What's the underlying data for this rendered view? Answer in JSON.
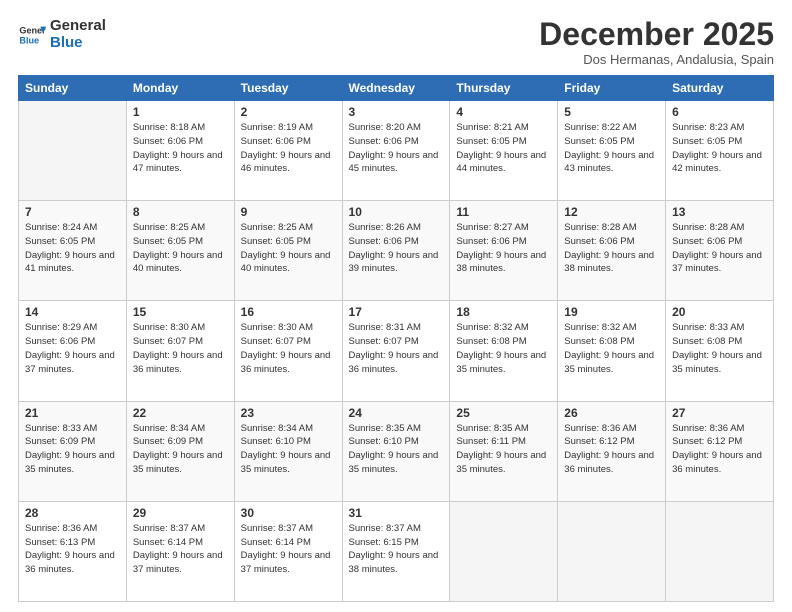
{
  "logo": {
    "line1": "General",
    "line2": "Blue"
  },
  "title": "December 2025",
  "subtitle": "Dos Hermanas, Andalusia, Spain",
  "days_header": [
    "Sunday",
    "Monday",
    "Tuesday",
    "Wednesday",
    "Thursday",
    "Friday",
    "Saturday"
  ],
  "weeks": [
    [
      {
        "num": "",
        "info": ""
      },
      {
        "num": "1",
        "info": "Sunrise: 8:18 AM\nSunset: 6:06 PM\nDaylight: 9 hours\nand 47 minutes."
      },
      {
        "num": "2",
        "info": "Sunrise: 8:19 AM\nSunset: 6:06 PM\nDaylight: 9 hours\nand 46 minutes."
      },
      {
        "num": "3",
        "info": "Sunrise: 8:20 AM\nSunset: 6:06 PM\nDaylight: 9 hours\nand 45 minutes."
      },
      {
        "num": "4",
        "info": "Sunrise: 8:21 AM\nSunset: 6:05 PM\nDaylight: 9 hours\nand 44 minutes."
      },
      {
        "num": "5",
        "info": "Sunrise: 8:22 AM\nSunset: 6:05 PM\nDaylight: 9 hours\nand 43 minutes."
      },
      {
        "num": "6",
        "info": "Sunrise: 8:23 AM\nSunset: 6:05 PM\nDaylight: 9 hours\nand 42 minutes."
      }
    ],
    [
      {
        "num": "7",
        "info": "Sunrise: 8:24 AM\nSunset: 6:05 PM\nDaylight: 9 hours\nand 41 minutes."
      },
      {
        "num": "8",
        "info": "Sunrise: 8:25 AM\nSunset: 6:05 PM\nDaylight: 9 hours\nand 40 minutes."
      },
      {
        "num": "9",
        "info": "Sunrise: 8:25 AM\nSunset: 6:05 PM\nDaylight: 9 hours\nand 40 minutes."
      },
      {
        "num": "10",
        "info": "Sunrise: 8:26 AM\nSunset: 6:06 PM\nDaylight: 9 hours\nand 39 minutes."
      },
      {
        "num": "11",
        "info": "Sunrise: 8:27 AM\nSunset: 6:06 PM\nDaylight: 9 hours\nand 38 minutes."
      },
      {
        "num": "12",
        "info": "Sunrise: 8:28 AM\nSunset: 6:06 PM\nDaylight: 9 hours\nand 38 minutes."
      },
      {
        "num": "13",
        "info": "Sunrise: 8:28 AM\nSunset: 6:06 PM\nDaylight: 9 hours\nand 37 minutes."
      }
    ],
    [
      {
        "num": "14",
        "info": "Sunrise: 8:29 AM\nSunset: 6:06 PM\nDaylight: 9 hours\nand 37 minutes."
      },
      {
        "num": "15",
        "info": "Sunrise: 8:30 AM\nSunset: 6:07 PM\nDaylight: 9 hours\nand 36 minutes."
      },
      {
        "num": "16",
        "info": "Sunrise: 8:30 AM\nSunset: 6:07 PM\nDaylight: 9 hours\nand 36 minutes."
      },
      {
        "num": "17",
        "info": "Sunrise: 8:31 AM\nSunset: 6:07 PM\nDaylight: 9 hours\nand 36 minutes."
      },
      {
        "num": "18",
        "info": "Sunrise: 8:32 AM\nSunset: 6:08 PM\nDaylight: 9 hours\nand 35 minutes."
      },
      {
        "num": "19",
        "info": "Sunrise: 8:32 AM\nSunset: 6:08 PM\nDaylight: 9 hours\nand 35 minutes."
      },
      {
        "num": "20",
        "info": "Sunrise: 8:33 AM\nSunset: 6:08 PM\nDaylight: 9 hours\nand 35 minutes."
      }
    ],
    [
      {
        "num": "21",
        "info": "Sunrise: 8:33 AM\nSunset: 6:09 PM\nDaylight: 9 hours\nand 35 minutes."
      },
      {
        "num": "22",
        "info": "Sunrise: 8:34 AM\nSunset: 6:09 PM\nDaylight: 9 hours\nand 35 minutes."
      },
      {
        "num": "23",
        "info": "Sunrise: 8:34 AM\nSunset: 6:10 PM\nDaylight: 9 hours\nand 35 minutes."
      },
      {
        "num": "24",
        "info": "Sunrise: 8:35 AM\nSunset: 6:10 PM\nDaylight: 9 hours\nand 35 minutes."
      },
      {
        "num": "25",
        "info": "Sunrise: 8:35 AM\nSunset: 6:11 PM\nDaylight: 9 hours\nand 35 minutes."
      },
      {
        "num": "26",
        "info": "Sunrise: 8:36 AM\nSunset: 6:12 PM\nDaylight: 9 hours\nand 36 minutes."
      },
      {
        "num": "27",
        "info": "Sunrise: 8:36 AM\nSunset: 6:12 PM\nDaylight: 9 hours\nand 36 minutes."
      }
    ],
    [
      {
        "num": "28",
        "info": "Sunrise: 8:36 AM\nSunset: 6:13 PM\nDaylight: 9 hours\nand 36 minutes."
      },
      {
        "num": "29",
        "info": "Sunrise: 8:37 AM\nSunset: 6:14 PM\nDaylight: 9 hours\nand 37 minutes."
      },
      {
        "num": "30",
        "info": "Sunrise: 8:37 AM\nSunset: 6:14 PM\nDaylight: 9 hours\nand 37 minutes."
      },
      {
        "num": "31",
        "info": "Sunrise: 8:37 AM\nSunset: 6:15 PM\nDaylight: 9 hours\nand 38 minutes."
      },
      {
        "num": "",
        "info": ""
      },
      {
        "num": "",
        "info": ""
      },
      {
        "num": "",
        "info": ""
      }
    ]
  ]
}
